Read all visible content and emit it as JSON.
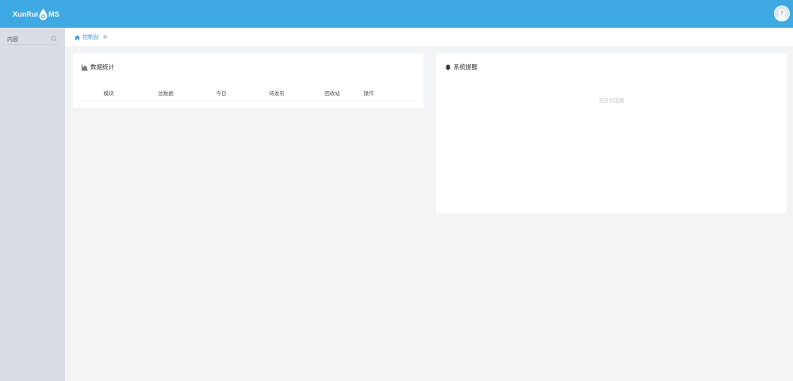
{
  "header": {
    "logo_left": "XunRui",
    "logo_right": "MS",
    "logo_drop_letter": "C"
  },
  "sidebar": {
    "search": {
      "placeholder": "内容"
    }
  },
  "breadcrumb": {
    "label": "控制台"
  },
  "stats_panel": {
    "title": "数据统计",
    "columns": [
      "模块",
      "总数据",
      "今日",
      "待发布",
      "回收站",
      "操作"
    ]
  },
  "notice_panel": {
    "title": "系统提醒",
    "empty_text": "无任何提醒"
  },
  "colors": {
    "header_bg": "#3ea9e3",
    "sidebar_bg": "#d9dde6",
    "accent": "#3598dc",
    "page_bg": "#f3f4f6"
  }
}
